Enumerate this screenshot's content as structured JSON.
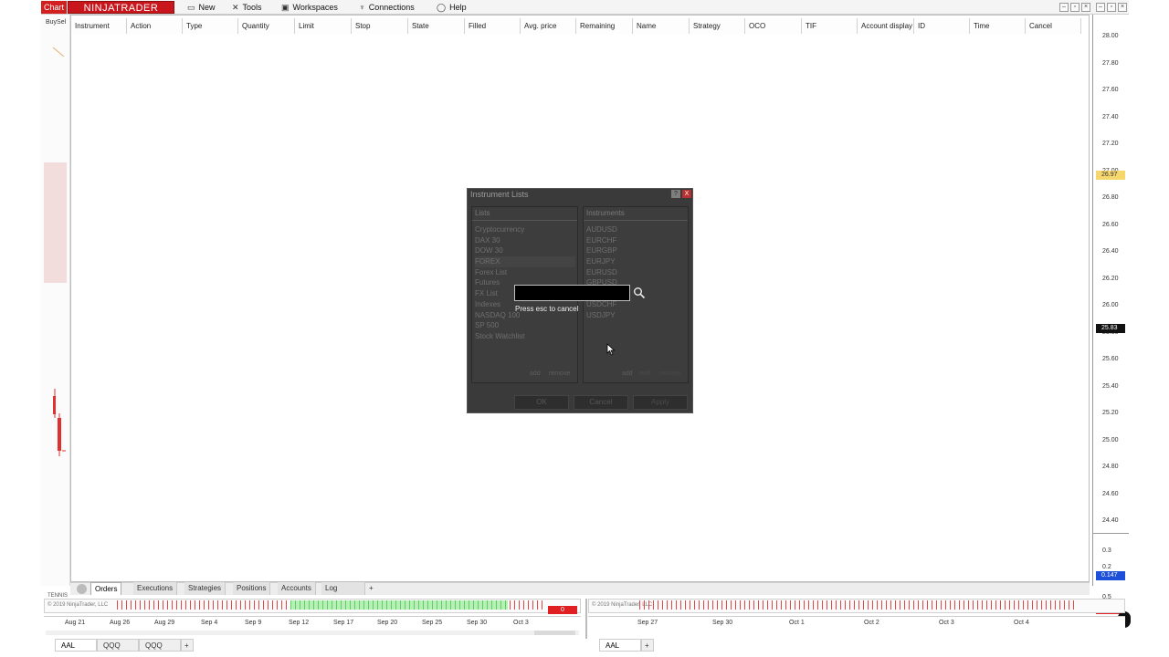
{
  "menubar": {
    "chart_tab": "Chart",
    "logo": "NINJATRADER",
    "items": [
      {
        "label": "New",
        "icon": "new-icon"
      },
      {
        "label": "Tools",
        "icon": "tools-icon"
      },
      {
        "label": "Workspaces",
        "icon": "workspaces-icon"
      },
      {
        "label": "Connections",
        "icon": "connections-icon"
      },
      {
        "label": "Help",
        "icon": "help-icon"
      }
    ]
  },
  "left": {
    "buysell": "BuySel"
  },
  "orders_grid": {
    "columns": [
      "Instrument",
      "Action",
      "Type",
      "Quantity",
      "Limit",
      "Stop",
      "State",
      "Filled",
      "Avg. price",
      "Remaining",
      "Name",
      "Strategy",
      "OCO",
      "TIF",
      "Account display",
      "ID",
      "Time",
      "Cancel"
    ]
  },
  "price_axis": {
    "labels": [
      "28.00",
      "27.80",
      "27.60",
      "27.40",
      "27.20",
      "27.00",
      "26.80",
      "26.60",
      "26.40",
      "26.20",
      "26.00",
      "25.80",
      "25.60",
      "25.40",
      "25.20",
      "25.00",
      "24.80",
      "24.60",
      "24.40",
      "0.3",
      "0.2",
      "0",
      "0.5",
      "1"
    ],
    "flag_yellow": "26.97",
    "flag_black": "25.83",
    "flag_blue": "0.147",
    "flag_red": "0"
  },
  "bottom_tabs": [
    "Orders",
    "Executions",
    "Strategies",
    "Positions",
    "Accounts",
    "Log"
  ],
  "bottom_tabs_add": "+",
  "mini_left": {
    "label": "TENNIS",
    "copyright": "© 2019 NinjaTrader, LLC",
    "value": "0",
    "dates": [
      "Aug 21",
      "Aug 26",
      "Aug 29",
      "Sep 4",
      "Sep 9",
      "Sep 12",
      "Sep 17",
      "Sep 20",
      "Sep 25",
      "Sep 30",
      "Oct 3"
    ]
  },
  "mini_right": {
    "copyright": "© 2019 NinjaTrader, LLC",
    "value": "0",
    "dates": [
      "Sep 27",
      "Sep 30",
      "Oct 1",
      "Oct 2",
      "Oct 3",
      "Oct 4"
    ]
  },
  "instrument_tabs_left": [
    "AAL",
    "QQQ",
    "QQQ"
  ],
  "instrument_tabs_right": [
    "AAL"
  ],
  "instrument_tabs_add": "+",
  "dialog": {
    "title": "Instrument Lists",
    "help_btn": "?",
    "close_btn": "X",
    "lists_header": "Lists",
    "lists": [
      "Cryptocurrency",
      "DAX 30",
      "DOW 30",
      "FOREX",
      "Forex List",
      "Futures",
      "FX List",
      "Indexes",
      "NASDAQ 100",
      "SP 500",
      "Stock Watchlist"
    ],
    "lists_add": "add",
    "lists_remove": "remove",
    "instruments_header": "Instruments",
    "instruments": [
      "AUDUSD",
      "EURCHF",
      "EURGBP",
      "EURJPY",
      "EURUSD",
      "GBPUSD",
      "USDCAD",
      "USDCHF",
      "USDJPY"
    ],
    "instruments_add": "add",
    "instruments_edit": "edit",
    "instruments_remove": "remove",
    "ok": "OK",
    "cancel": "Cancel",
    "apply": "Apply"
  },
  "search_popup": {
    "value": "",
    "hint": "Press esc to cancel"
  }
}
